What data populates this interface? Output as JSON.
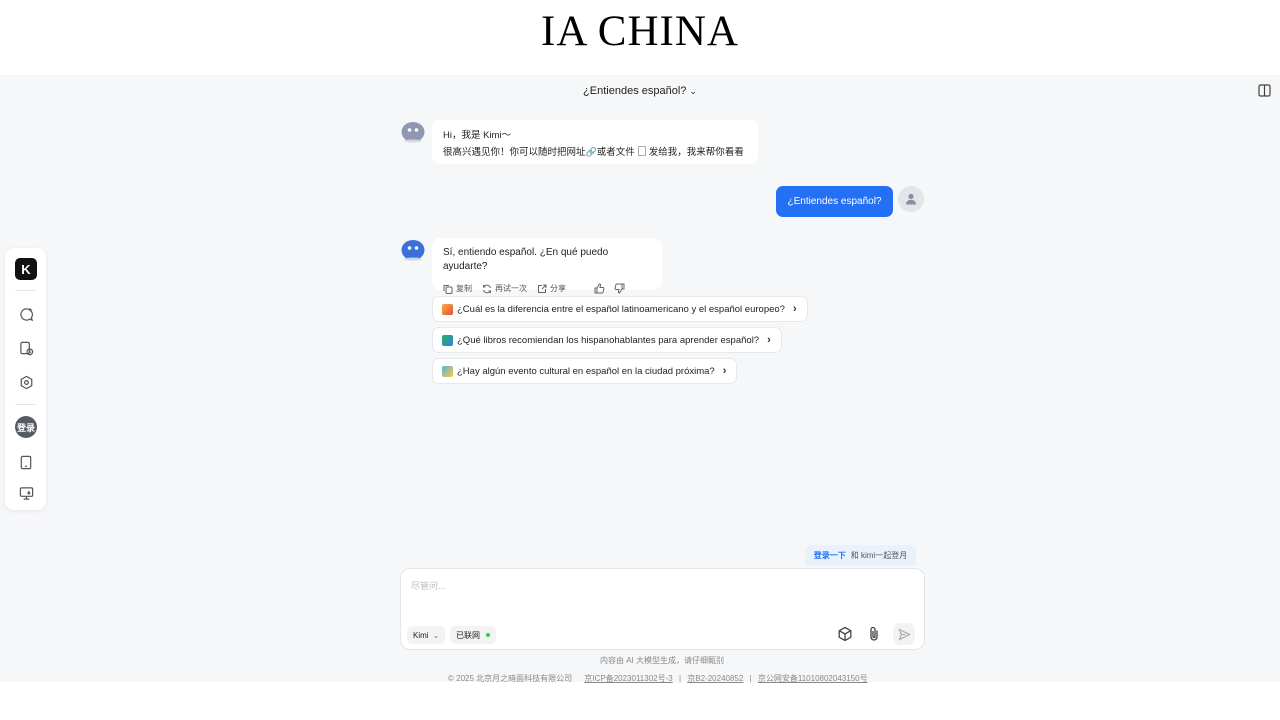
{
  "banner": {
    "title": "IA CHINA"
  },
  "chat": {
    "title": "¿Entiendes español?",
    "greeting": {
      "line1": "Hi，我是 Kimi～",
      "line2_a": "很高兴遇见你！你可以随时把网址",
      "line2_b": "或者文件",
      "line2_c": "发给我，我来帮你看看"
    },
    "user_message": "¿Entiendes español?",
    "reply": {
      "text": "Sí, entiendo español. ¿En qué puedo ayudarte?",
      "copy_label": "复制",
      "retry_label": "再试一次",
      "share_label": "分享"
    },
    "suggestions": [
      "¿Cuál es la diferencia entre el español latinoamericano y el español europeo?",
      "¿Qué libros recomiendan los hispanohablantes para aprender español?",
      "¿Hay algún evento cultural en español en la ciudad próxima?"
    ]
  },
  "sidebar": {
    "logo": "K",
    "login_label": "登录"
  },
  "login_tip": {
    "link": "登录一下",
    "text": "和 kimi一起登月"
  },
  "composer": {
    "placeholder": "尽管问...",
    "model_label": "Kimi",
    "network_label": "已联网"
  },
  "disclaimer": "内容由 AI 大模型生成，请仔细甄别",
  "footer": {
    "copyright": "© 2025 北京月之暗面科技有限公司",
    "icp": "京ICP备2023011302号-3",
    "b2": "京B2-20240852",
    "police": "京公网安备11010802043150号"
  },
  "colors": {
    "accent": "#2470f5",
    "online": "#2ecc52",
    "background": "#f6f7f9"
  }
}
